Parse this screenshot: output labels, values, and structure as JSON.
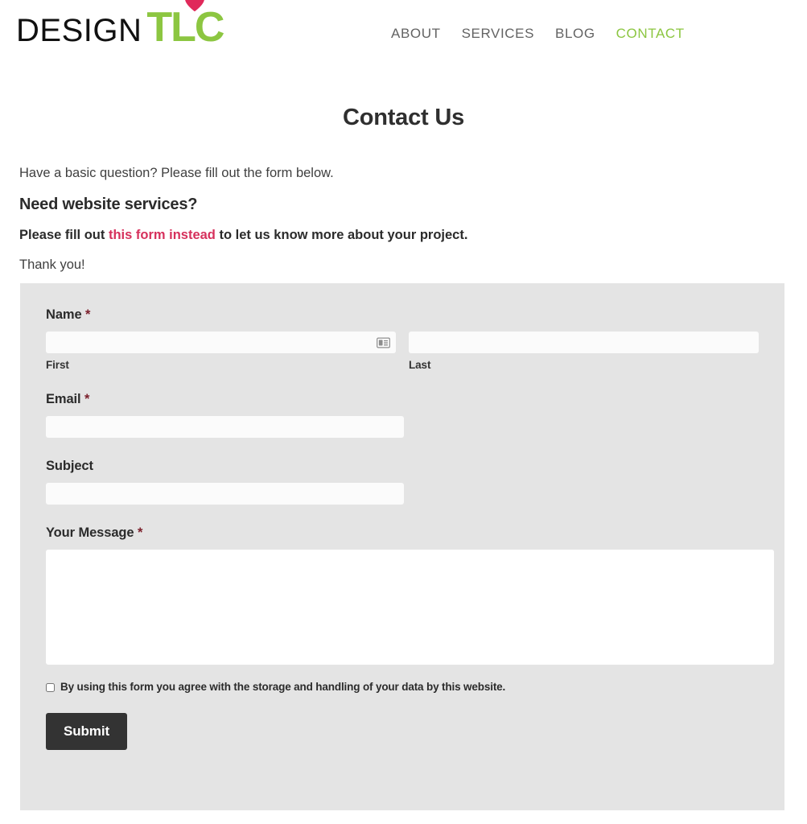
{
  "header": {
    "logo": {
      "word_mark_primary": "DESIGN",
      "word_mark_accent": "TLC",
      "heart_icon_name": "heart-icon",
      "green_hex": "#8CC641",
      "heart_hex": "#E0295A"
    },
    "nav": [
      {
        "label": "ABOUT",
        "active": false
      },
      {
        "label": "SERVICES",
        "active": false
      },
      {
        "label": "BLOG",
        "active": false
      },
      {
        "label": "CONTACT",
        "active": true
      }
    ]
  },
  "page": {
    "title": "Contact Us"
  },
  "intro": {
    "line1": "Have a basic question? Please fill out the form below.",
    "heading": "Need website services?",
    "cta_prefix": "Please fill out ",
    "cta_link": "this form instead",
    "cta_suffix": " to let us know more about your project.",
    "thanks": "Thank you!",
    "link_hex": "#D6305C"
  },
  "form": {
    "background_hex": "#E4E4E4",
    "required_marker": "*",
    "name": {
      "label": "Name",
      "required": true,
      "first": {
        "value": "",
        "placeholder": "",
        "sub_label": "First",
        "icon": "contact-card-autofill-icon"
      },
      "last": {
        "value": "",
        "placeholder": "",
        "sub_label": "Last"
      }
    },
    "email": {
      "label": "Email",
      "required": true,
      "value": "",
      "placeholder": ""
    },
    "subject": {
      "label": "Subject",
      "required": false,
      "value": "",
      "placeholder": ""
    },
    "message": {
      "label": "Your Message",
      "required": true,
      "value": "",
      "placeholder": ""
    },
    "consent": {
      "checked": false,
      "text": "By using this form you agree with the storage and handling of your data by this website."
    },
    "submit": {
      "label": "Submit",
      "background_hex": "#333333",
      "text_hex": "#FFFFFF"
    }
  }
}
